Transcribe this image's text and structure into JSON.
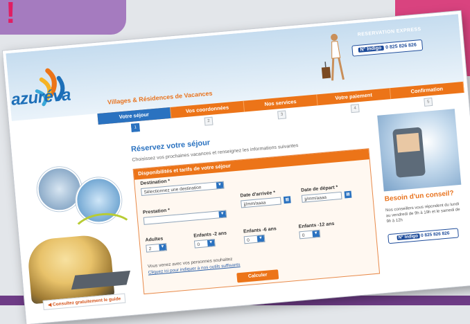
{
  "header": {
    "reservation_link": "RESERVATION EXPRESS",
    "phone_prefix": "N° Indigo",
    "phone_number": "0 825 826 826",
    "logo_text": "azuréva",
    "tagline": "Villages & Résidences de Vacances"
  },
  "steps": [
    {
      "label": "Votre séjour",
      "num": "1",
      "active": true
    },
    {
      "label": "Vos coordonnées",
      "num": "2",
      "active": false
    },
    {
      "label": "Nos services",
      "num": "3",
      "active": false
    },
    {
      "label": "Votre paiement",
      "num": "4",
      "active": false
    },
    {
      "label": "Confirmation",
      "num": "5",
      "active": false
    }
  ],
  "main": {
    "title": "Réservez votre séjour",
    "description": "Choisissez vos prochaines vacances et renseignez les informations suivantes"
  },
  "form": {
    "panel_title": "Disponibilités et tarifs de votre séjour",
    "destination_label": "Destination *",
    "destination_value": "Sélectionnez une destination",
    "prestation_label": "Prestation *",
    "prestation_value": "",
    "arrival_label": "Date d'arrivée *",
    "arrival_value": "jj/mm/aaaa",
    "departure_label": "Date de départ *",
    "departure_value": "jj/mm/aaaa",
    "adults_label": "Adultes",
    "adults_value": "2",
    "children1_label": "Enfants -2 ans",
    "children1_value": "0",
    "children2_label": "Enfants -6 ans",
    "children2_value": "0",
    "children3_label": "Enfants -12 ans",
    "children3_value": "0",
    "note": "Vous venez avec vos personnes souhaitez",
    "note_link": "Cliquez ici pour indiquer à nos outils suffisants",
    "calc_button": "Calculer"
  },
  "left": {
    "cta": "Consultez gratuitement le guide"
  },
  "right": {
    "advice_title": "Besoin d'un conseil?",
    "advice_text": "Nos conseillers vous répondent du lundi au vendredi de 9h à 19h et le samedi de 9h à 12h",
    "phone_prefix": "N° Indigo",
    "phone_number": "0 825 826 826"
  },
  "colors": {
    "orange": "#ec7418",
    "blue": "#2a72c0",
    "purple": "#a57bbf",
    "pink": "#d9437f"
  }
}
